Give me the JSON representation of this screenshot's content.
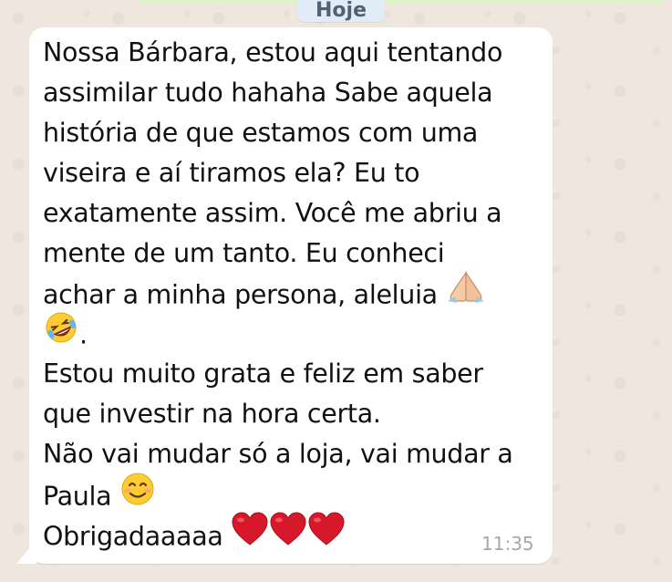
{
  "chat": {
    "date_chip": "Hoje",
    "message": {
      "lines": [
        "Nossa Bárbara, estou aqui tentando",
        "assimilar tudo hahaha Sabe aquela",
        "história de que estamos com uma",
        "viseira e aí tiramos ela? Eu to",
        "exatamente assim. Você me abriu a",
        "mente de um tanto. Eu conheci",
        "achar a minha persona, aleluia",
        ".",
        "Estou muito grata e feliz em saber",
        "que investir na hora certa.",
        "Não vai mudar só a loja, vai mudar a",
        "Paula",
        "Obrigadaaaaa"
      ],
      "time": "11:35",
      "emojis": {
        "line7": "praying-hands-icon",
        "line8": "rolling-on-floor-laughing-icon",
        "line12": "smiling-face-icon",
        "line13": [
          "red-heart-icon",
          "red-heart-icon",
          "red-heart-icon"
        ]
      }
    }
  },
  "colors": {
    "wallpaper": "#efe7de",
    "bubble": "#ffffff",
    "date_chip": "#e1ecf7",
    "heart": "#d7182a",
    "emoji_yellow": "#ffcc33"
  }
}
